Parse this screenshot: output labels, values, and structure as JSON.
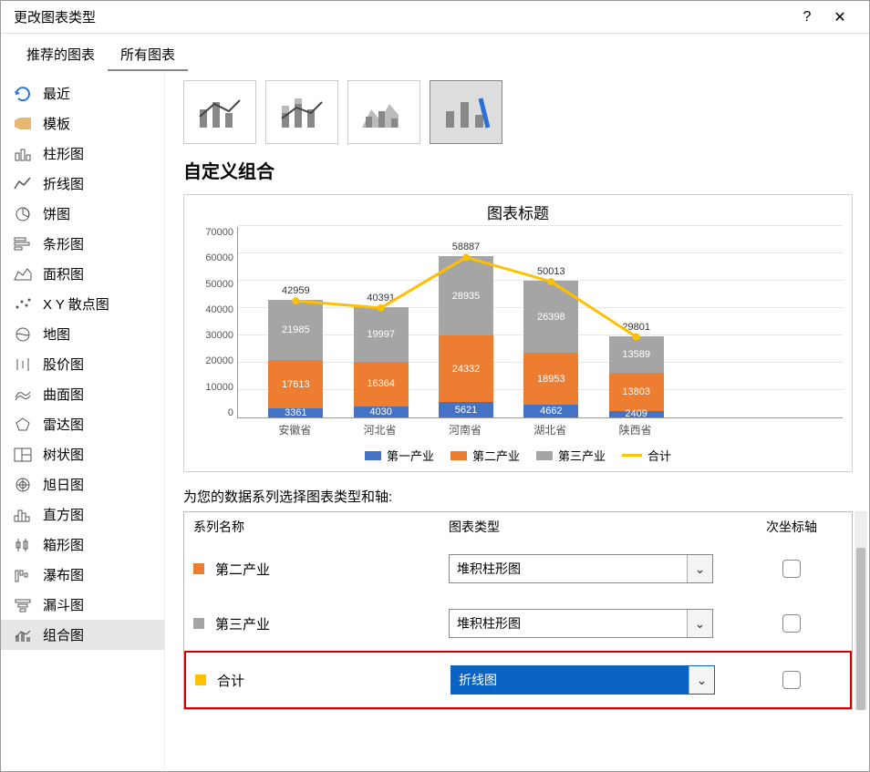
{
  "dialog_title": "更改图表类型",
  "tabs": {
    "recommended": "推荐的图表",
    "all": "所有图表"
  },
  "sidebar": {
    "items": [
      {
        "label": "最近",
        "icon": "recent"
      },
      {
        "label": "模板",
        "icon": "template"
      },
      {
        "label": "柱形图",
        "icon": "column"
      },
      {
        "label": "折线图",
        "icon": "line"
      },
      {
        "label": "饼图",
        "icon": "pie"
      },
      {
        "label": "条形图",
        "icon": "bar"
      },
      {
        "label": "面积图",
        "icon": "area"
      },
      {
        "label": "X Y 散点图",
        "icon": "scatter"
      },
      {
        "label": "地图",
        "icon": "map"
      },
      {
        "label": "股价图",
        "icon": "stock"
      },
      {
        "label": "曲面图",
        "icon": "surface"
      },
      {
        "label": "雷达图",
        "icon": "radar"
      },
      {
        "label": "树状图",
        "icon": "treemap"
      },
      {
        "label": "旭日图",
        "icon": "sunburst"
      },
      {
        "label": "直方图",
        "icon": "histo"
      },
      {
        "label": "箱形图",
        "icon": "box"
      },
      {
        "label": "瀑布图",
        "icon": "waterfall"
      },
      {
        "label": "漏斗图",
        "icon": "funnel"
      },
      {
        "label": "组合图",
        "icon": "combo"
      }
    ]
  },
  "content": {
    "heading": "自定义组合",
    "series_help": "为您的数据系列选择图表类型和轴:",
    "table_headers": {
      "name": "系列名称",
      "type": "图表类型",
      "axis": "次坐标轴"
    },
    "series_rows": [
      {
        "name": "第二产业",
        "type": "堆积柱形图",
        "color": "#ed7d31"
      },
      {
        "name": "第三产业",
        "type": "堆积柱形图",
        "color": "#a5a5a5"
      },
      {
        "name": "合计",
        "type": "折线图",
        "color": "#ffc000"
      }
    ]
  },
  "chart_data": {
    "type": "combo",
    "title": "图表标题",
    "categories": [
      "安徽省",
      "河北省",
      "河南省",
      "湖北省",
      "陕西省"
    ],
    "ylim": [
      0,
      70000
    ],
    "ytick": 10000,
    "series": [
      {
        "name": "第一产业",
        "type": "bar",
        "color": "#4472c4",
        "values": [
          3361,
          4030,
          5621,
          4662,
          2409
        ]
      },
      {
        "name": "第二产业",
        "type": "bar",
        "color": "#ed7d31",
        "values": [
          17613,
          16364,
          24332,
          18953,
          13803
        ]
      },
      {
        "name": "第三产业",
        "type": "bar",
        "color": "#a5a5a5",
        "values": [
          21985,
          19997,
          28935,
          26398,
          13589
        ]
      },
      {
        "name": "合计",
        "type": "line",
        "color": "#ffc000",
        "values": [
          42959,
          40391,
          58887,
          50013,
          29801
        ]
      }
    ]
  }
}
